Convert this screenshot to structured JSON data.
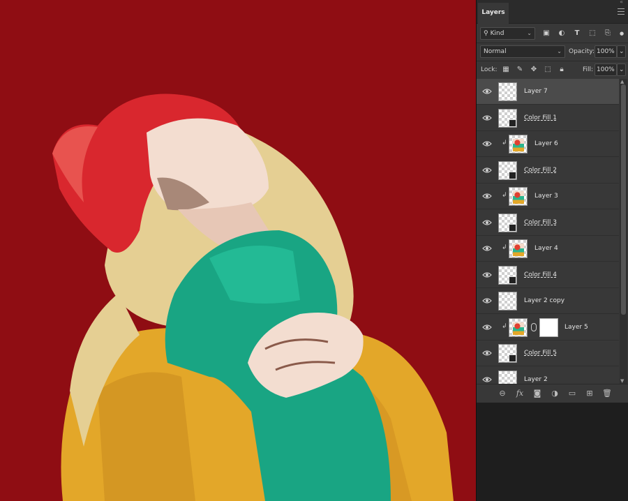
{
  "panel": {
    "tab_label": "Layers",
    "filter_kind": "Kind",
    "blend_mode": "Normal",
    "opacity_label": "Opacity:",
    "opacity_value": "100%",
    "lock_label": "Lock:",
    "fill_label": "Fill:",
    "fill_value": "100%"
  },
  "layers": [
    {
      "name": "Layer 7",
      "thumb": "transparent",
      "selected": true,
      "clipped": false,
      "fill": false
    },
    {
      "name": "Color Fill 1",
      "thumb": "transparent",
      "selected": false,
      "clipped": false,
      "fill": true
    },
    {
      "name": "Layer 6",
      "thumb": "art",
      "selected": false,
      "clipped": true,
      "fill": false
    },
    {
      "name": "Color Fill 2",
      "thumb": "transparent",
      "selected": false,
      "clipped": false,
      "fill": true
    },
    {
      "name": "Layer 3",
      "thumb": "art",
      "selected": false,
      "clipped": true,
      "fill": false
    },
    {
      "name": "Color Fill 3",
      "thumb": "transparent",
      "selected": false,
      "clipped": false,
      "fill": true
    },
    {
      "name": "Layer 4",
      "thumb": "art",
      "selected": false,
      "clipped": true,
      "fill": false
    },
    {
      "name": "Color Fill 4",
      "thumb": "transparent",
      "selected": false,
      "clipped": false,
      "fill": true
    },
    {
      "name": "Layer 2 copy",
      "thumb": "transparent",
      "selected": false,
      "clipped": false,
      "fill": false
    },
    {
      "name": "Layer 5",
      "thumb": "art",
      "selected": false,
      "clipped": true,
      "fill": false,
      "mask": true
    },
    {
      "name": "Color Fill 5",
      "thumb": "transparent",
      "selected": false,
      "clipped": false,
      "fill": true
    },
    {
      "name": "Layer 2",
      "thumb": "transparent",
      "selected": false,
      "clipped": false,
      "fill": false
    }
  ],
  "colors": {
    "canvas_bg": "#8f0d13",
    "hat": "#d9272e",
    "skin": "#f3ddd0",
    "hair": "#e5cf93",
    "sweater_teal": "#19a583",
    "coat_yellow": "#e3a729"
  },
  "icons": {
    "filter": "search-icon",
    "footer": [
      "link-icon",
      "fx-icon",
      "mask-icon",
      "adjustment-icon",
      "folder-icon",
      "new-layer-icon",
      "trash-icon"
    ]
  }
}
